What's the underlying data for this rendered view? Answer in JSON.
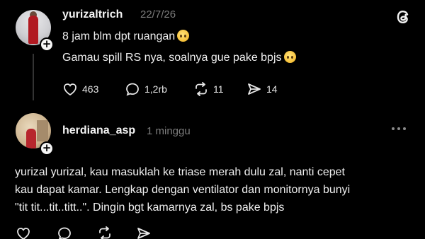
{
  "post": {
    "username": "yurizaltrich",
    "date": "22/7/26",
    "lines": [
      "8 jam blm dpt ruangan",
      "Gamau spill RS nya, soalnya gue pake bpjs"
    ],
    "emojis": [
      "worried-face-emoji",
      "pleading-face-emoji"
    ],
    "actions": {
      "likes": "463",
      "comments": "1,2rb",
      "reposts": "11",
      "shares": "14"
    }
  },
  "reply": {
    "username": "herdiana_asp",
    "time": "1 minggu",
    "lines": [
      "yurizal yurizal, kau masuklah ke triase merah dulu zal, nanti cepet",
      "kau dapat kamar. Lengkap dengan ventilator dan monitornya bunyi",
      "\"tit tit...tit..titt..\". Dingin bgt kamarnya zal, bs pake bpjs"
    ]
  },
  "icons": {
    "logo": "threads-logo-icon",
    "like": "heart-icon",
    "comment": "comment-bubble-icon",
    "repost": "repost-icon",
    "share": "send-icon",
    "more": "more-dots-icon",
    "follow": "plus-icon"
  },
  "colors": {
    "background": "#000000",
    "text": "#efefef",
    "muted": "#7d7d7d"
  }
}
